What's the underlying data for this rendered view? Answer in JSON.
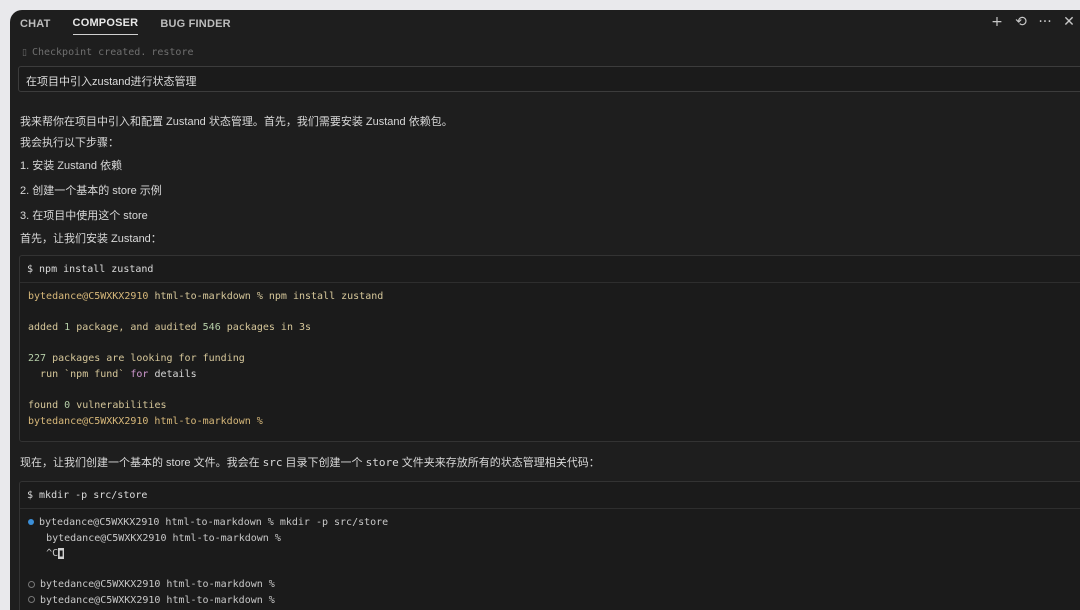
{
  "tabs": [
    {
      "label": "CHAT"
    },
    {
      "label": "COMPOSER"
    },
    {
      "label": "BUG FINDER"
    }
  ],
  "tab_actions": {
    "new": "+",
    "history": "⟲",
    "more": "···",
    "close": "✕"
  },
  "checkpoint": {
    "text": "Checkpoint created.",
    "restore": "restore"
  },
  "query": "在项目中引入zustand进行状态管理",
  "messages": {
    "intro": "我来帮你在项目中引入和配置 Zustand 状态管理。首先，我们需要安装 Zustand 依赖包。",
    "steps_heading": "我会执行以下步骤：",
    "step1": "1. 安装 Zustand 依赖",
    "step2": "2. 创建一个基本的 store 示例",
    "step3": "3. 在项目中使用这个 store",
    "first": "首先，让我们安装 Zustand：",
    "now_a": "现在，让我们创建一个基本的 store 文件。我会在 ",
    "now_src": "src",
    "now_b": " 目录下创建一个 ",
    "now_store": "store",
    "now_c": " 文件夹来存放所有的状态管理相关代码："
  },
  "cmd1": {
    "dollar": "$",
    "command": "npm install zustand",
    "user": "bytedance@C5WXKX2910",
    "dir": "html-to-markdown",
    "pct": "%",
    "typed": "npm install zustand",
    "added_a": "added",
    "added_n1": "1",
    "added_b": "package, and audited",
    "added_n2": "546",
    "added_c": "packages in 3s",
    "fund_n": "227",
    "fund_a": "packages are looking for funding",
    "fund_run": "run `npm fund`",
    "fund_for": "for",
    "fund_details": "details",
    "found_a": "found",
    "found_n": "0",
    "found_b": "vulnerabilities",
    "final_prompt": "bytedance@C5WXKX2910 html-to-markdown %"
  },
  "cmd2": {
    "dollar": "$",
    "command": "mkdir -p src/store",
    "line1": "bytedance@C5WXKX2910 html-to-markdown % mkdir -p src/store",
    "line2": "bytedance@C5WXKX2910 html-to-markdown %",
    "line3": "^C",
    "line4": "bytedance@C5WXKX2910 html-to-markdown %",
    "line5": "bytedance@C5WXKX2910 html-to-markdown %"
  }
}
